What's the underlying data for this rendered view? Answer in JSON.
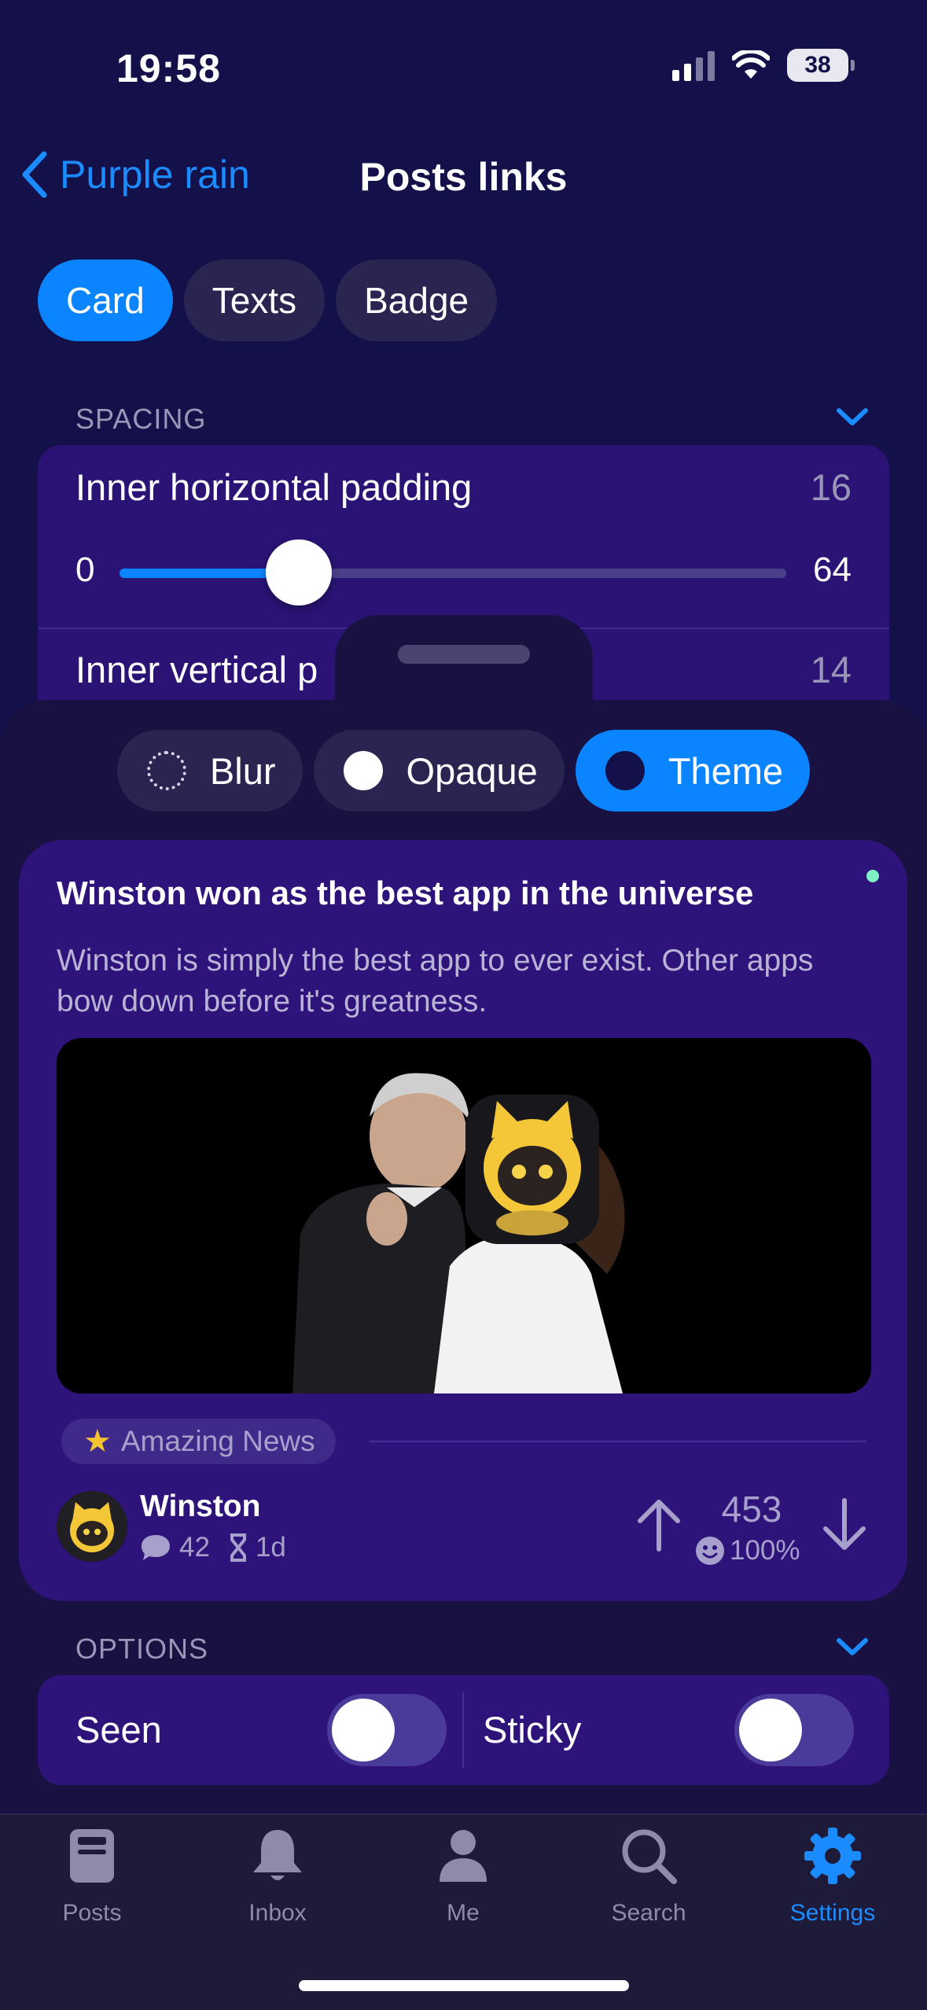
{
  "status": {
    "time": "19:58",
    "battery": "38"
  },
  "nav": {
    "back_label": "Purple rain",
    "title": "Posts links"
  },
  "tabs": [
    {
      "label": "Card",
      "active": true
    },
    {
      "label": "Texts",
      "active": false
    },
    {
      "label": "Badge",
      "active": false
    }
  ],
  "spacing": {
    "section_label": "SPACING",
    "inner_horizontal": {
      "label": "Inner horizontal padding",
      "value": "16",
      "min": "0",
      "max": "64"
    },
    "inner_vertical": {
      "label": "Inner vertical p",
      "value": "14"
    }
  },
  "background_options": [
    {
      "label": "Blur",
      "icon": "dotted-circle-icon",
      "active": false
    },
    {
      "label": "Opaque",
      "icon": "white-circle-icon",
      "active": false
    },
    {
      "label": "Theme",
      "icon": "dark-circle-icon",
      "active": true
    }
  ],
  "post": {
    "title": "Winston won as the best app in the universe",
    "body": "Winston is simply the best app to ever exist. Other apps bow down before it's greatness.",
    "flair": "Amazing News",
    "author": "Winston",
    "comments": "42",
    "age": "1d",
    "score": "453",
    "ratio": "100%"
  },
  "options": {
    "section_label": "OPTIONS",
    "seen_label": "Seen",
    "sticky_label": "Sticky"
  },
  "tabbar": [
    {
      "label": "Posts",
      "icon": "posts-icon",
      "active": false
    },
    {
      "label": "Inbox",
      "icon": "bell-icon",
      "active": false
    },
    {
      "label": "Me",
      "icon": "person-icon",
      "active": false
    },
    {
      "label": "Search",
      "icon": "search-icon",
      "active": false
    },
    {
      "label": "Settings",
      "icon": "gear-icon",
      "active": true
    }
  ],
  "colors": {
    "accent": "#0a84ff",
    "background": "#13104a",
    "card": "#2d137a"
  }
}
